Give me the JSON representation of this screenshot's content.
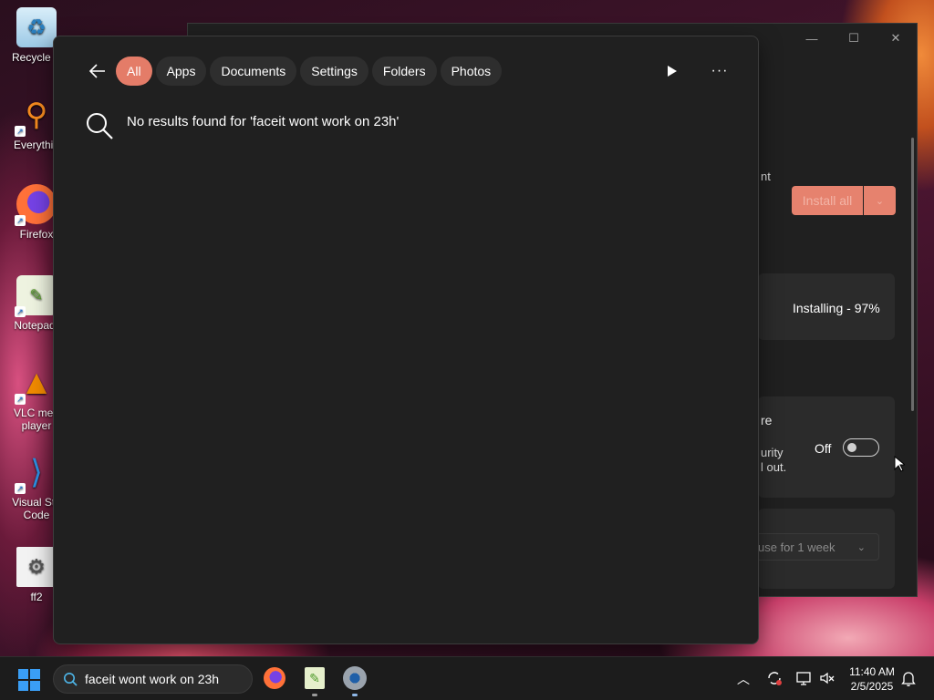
{
  "desktop": {
    "icons": [
      {
        "label": "Recycle B",
        "icon": "recycle-bin-icon"
      },
      {
        "label": "Everythin",
        "icon": "everything-search-icon"
      },
      {
        "label": "Firefox",
        "icon": "firefox-icon"
      },
      {
        "label": "Notepad-",
        "icon": "notepad-plus-plus-icon"
      },
      {
        "label": "VLC med",
        "label2": "player",
        "icon": "vlc-icon"
      },
      {
        "label": "Visual Stu",
        "label2": "Code",
        "icon": "vscode-icon"
      },
      {
        "label": "ff2",
        "icon": "settings-shortcut-icon"
      }
    ]
  },
  "background_window": {
    "install_all_label": "Install all",
    "install_status": "Installing - 97%",
    "partial_text_1": "nt",
    "partial_text_2": "re",
    "partial_text_3": "urity",
    "partial_text_4": "l out.",
    "toggle_label": "Off",
    "pause_label": "use for 1 week"
  },
  "search": {
    "tabs": [
      {
        "label": "All",
        "active": true
      },
      {
        "label": "Apps"
      },
      {
        "label": "Documents"
      },
      {
        "label": "Settings"
      },
      {
        "label": "Folders"
      },
      {
        "label": "Photos"
      }
    ],
    "no_results_text": "No results found for 'faceit wont work on 23h'"
  },
  "taskbar": {
    "search_value": "faceit wont work on 23h",
    "time": "11:40 AM",
    "date": "2/5/2025"
  },
  "colors": {
    "accent": "#e47c68",
    "flyout_bg": "#202020",
    "chip_bg": "#2e2e2e",
    "start_blue": "#3a9ef5"
  }
}
